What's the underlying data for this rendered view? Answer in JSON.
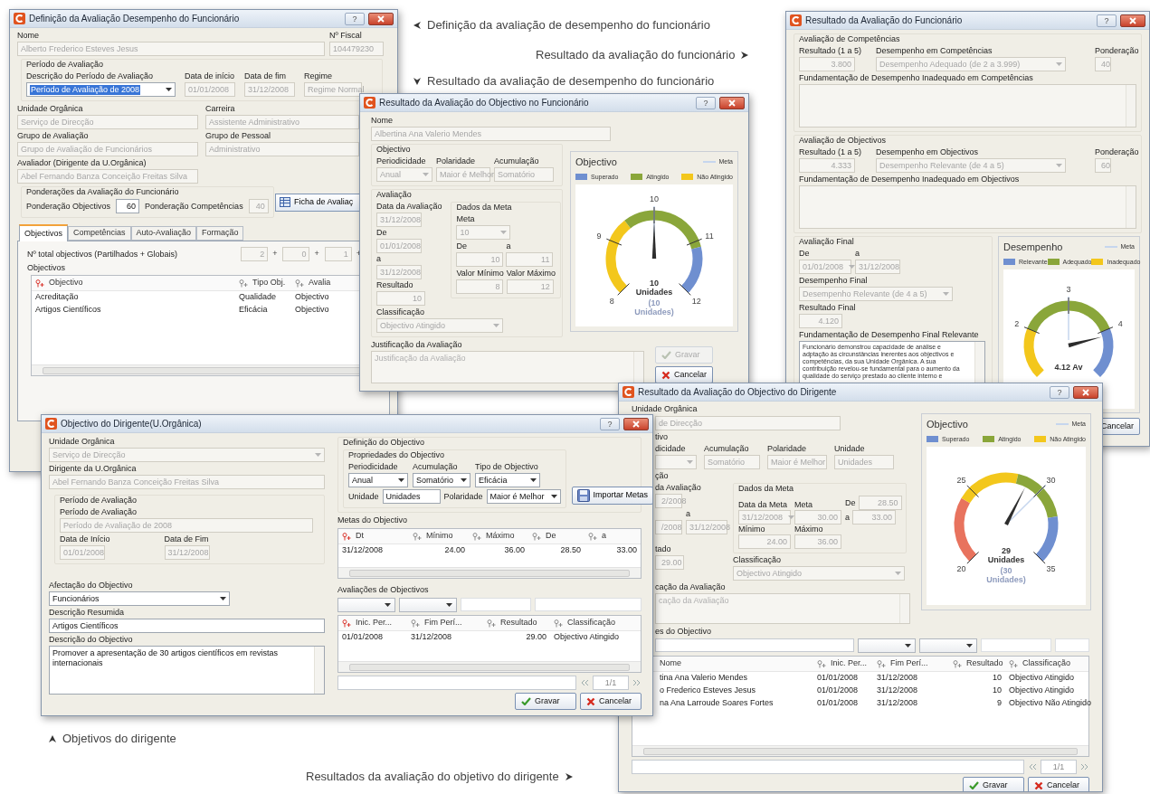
{
  "captions": [
    {
      "text": "Definição da avaliação de desempenho do funcionário",
      "kind": "left"
    },
    {
      "text": "Resultado da avaliação do funcionário",
      "kind": "right"
    },
    {
      "text": "Resultado da avaliação de desempenho do funcionário",
      "kind": "down"
    },
    {
      "text": "Objetivos do dirigente",
      "kind": "up"
    },
    {
      "text": "Resultados da avaliação do objetivo do dirigente",
      "kind": "right"
    }
  ],
  "windows": [
    {
      "kind": "definicao",
      "title": "Definição da Avaliação Desempenho do Funcionário",
      "help": "?",
      "nome": {
        "label": "Nome",
        "value": "Alberto Frederico Esteves Jesus",
        "kind": "text",
        "disabled": true
      },
      "nif": {
        "label": "Nº Fiscal",
        "value": "104479230",
        "kind": "text",
        "disabled": true
      },
      "periodo_group": "Período de Avaliação",
      "descricao": {
        "label": "Descrição do Período de Avaliação",
        "value": "Período de Avaliação de 2008",
        "kind": "combo",
        "disabled": false,
        "selected": true
      },
      "data_inicio": {
        "label": "Data de início",
        "value": "01/01/2008",
        "kind": "text",
        "disabled": true
      },
      "data_fim": {
        "label": "Data de fim",
        "value": "31/12/2008",
        "kind": "text",
        "disabled": true
      },
      "regime": {
        "label": "Regime",
        "value": "Regime Normal",
        "kind": "text",
        "disabled": true
      },
      "unidade": {
        "label": "Unidade Orgânica",
        "value": "Serviço de Direcção",
        "kind": "text",
        "disabled": true
      },
      "carreira": {
        "label": "Carreira",
        "value": "Assistente Administrativo",
        "kind": "text",
        "disabled": true
      },
      "grupo": {
        "label": "Grupo de Avaliação",
        "value": "Grupo de Avaliação de Funcionários",
        "kind": "text",
        "disabled": true
      },
      "pessoal": {
        "label": "Grupo de Pessoal",
        "value": "Administrativo",
        "kind": "text",
        "disabled": true
      },
      "avaliador": {
        "label": "Avaliador (Dirigente da U.Orgânica)",
        "value": "Abel Fernando Banza Conceição Freitas Silva",
        "kind": "text",
        "disabled": true
      },
      "ponderacoes_group": "Ponderações da Avaliação do Funcionário",
      "pond_obj": {
        "label": "Ponderação Objectivos",
        "value": "60",
        "kind": "text",
        "disabled": false
      },
      "pond_comp": {
        "label": "Ponderação Competências",
        "value": "40",
        "kind": "text",
        "disabled": true
      },
      "ficha_button": "Ficha de Avaliaç",
      "tabs": [
        {
          "label": "Objectivos",
          "selected": true
        },
        {
          "label": "Competências",
          "selected": false
        },
        {
          "label": "Auto-Avaliação",
          "selected": false
        },
        {
          "label": "Formação",
          "selected": false
        }
      ],
      "total_label": "Nº total objectivos (Partilhados + Globais)",
      "counts": [
        {
          "value": "2",
          "op": "+"
        },
        {
          "value": "0",
          "op": "+"
        },
        {
          "value": "1",
          "op": "+"
        }
      ],
      "objectivos_label": "Objectivos",
      "table": {
        "columns": [
          {
            "label": "Objectivo",
            "sorted": true
          },
          {
            "label": "Tipo Obj.",
            "sorted": false
          },
          {
            "label": "Avalia",
            "sorted": false
          }
        ],
        "rows": [
          [
            "Acreditação",
            "Qualidade",
            "Objectivo"
          ],
          [
            "Artigos Científicos",
            "Eficácia",
            "Objectivo"
          ]
        ]
      }
    },
    {
      "kind": "resultado_objectivo",
      "title": "Resultado da Avaliação do Objectivo no Funcionário",
      "help": "?",
      "nome": {
        "label": "Nome",
        "value": "Albertina Ana Valerio Mendes",
        "kind": "text",
        "disabled": true
      },
      "objectivo_group": "Objectivo",
      "periodicidade": {
        "label": "Periodicidade",
        "value": "Anual",
        "kind": "combo",
        "disabled": true
      },
      "polaridade": {
        "label": "Polaridade",
        "value": "Maior é Melhor",
        "kind": "text",
        "disabled": true
      },
      "acumulacao": {
        "label": "Acumulação",
        "value": "Somatório",
        "kind": "text",
        "disabled": true
      },
      "avaliacao_group": "Avaliação",
      "data_avaliacao": {
        "label": "Data da Avaliação",
        "value": "31/12/2008",
        "kind": "text",
        "disabled": true
      },
      "de": {
        "label": "De",
        "value": "01/01/2008",
        "kind": "text",
        "disabled": true
      },
      "a": {
        "label": "a",
        "value": "31/12/2008",
        "kind": "text",
        "disabled": true
      },
      "resultado": {
        "label": "Resultado",
        "value": "10",
        "kind": "text",
        "disabled": true
      },
      "meta_group": "Dados da Meta",
      "meta": {
        "label": "Meta",
        "value": "10",
        "kind": "combo",
        "disabled": true
      },
      "meta_de": {
        "label": "De",
        "value": "10",
        "kind": "text",
        "disabled": true
      },
      "meta_a": {
        "label": "a",
        "value": "11",
        "kind": "text",
        "disabled": true
      },
      "minimo": {
        "label": "Valor Mínimo",
        "value": "8",
        "kind": "text",
        "disabled": true
      },
      "maximo": {
        "label": "Valor Máximo",
        "value": "12",
        "kind": "text",
        "disabled": true
      },
      "classificacao": {
        "label": "Classificação",
        "value": "Objectivo Atingido",
        "kind": "combo",
        "disabled": true
      },
      "chart": {
        "title": "Objectivo",
        "target_legend": "Meta",
        "legend": [
          {
            "label": "Superado",
            "color": "#6f8fd0"
          },
          {
            "label": "Atingido",
            "color": "#8aa63a"
          },
          {
            "label": "Não Atingido",
            "color": "#f3c71c"
          }
        ],
        "gauge": {
          "ticks": [
            "8",
            "9",
            "10",
            "11",
            "12"
          ],
          "value": "10",
          "unit": "Unidades",
          "target_lines": [
            "(10",
            "Unidades)"
          ],
          "level": 0.5
        }
      },
      "justificacao": {
        "label": "Justificação da Avaliação",
        "placeholder": "Justificação da Avaliação",
        "kind": "textarea",
        "disabled": true
      },
      "buttons": [
        {
          "label": "Gravar",
          "kind": "save",
          "disabled": true
        },
        {
          "label": "Cancelar",
          "kind": "cancel",
          "disabled": false
        }
      ]
    },
    {
      "kind": "resultado_funcionario",
      "title": "Resultado da Avaliação do Funcionário",
      "help": "?",
      "competencias": {
        "group": "Avaliação de Competências",
        "resultado": {
          "label": "Resultado (1 a 5)",
          "value": "3.800",
          "kind": "text",
          "disabled": true
        },
        "desempenho": {
          "label": "Desempenho em Competências",
          "value": "Desempenho Adequado (de 2 a 3.999)",
          "kind": "combo",
          "disabled": true
        },
        "ponderacao": {
          "label": "Ponderação",
          "value": "40",
          "kind": "text",
          "disabled": true
        },
        "fundamentacao": {
          "label": "Fundamentação de Desempenho Inadequado em Competências",
          "kind": "textarea",
          "disabled": true
        }
      },
      "objectivos": {
        "group": "Avaliação de Objectivos",
        "resultado": {
          "label": "Resultado (1 a 5)",
          "value": "4.333",
          "kind": "text",
          "disabled": true
        },
        "desempenho": {
          "label": "Desempenho em Objectivos",
          "value": "Desempenho Relevante (de 4 a 5)",
          "kind": "combo",
          "disabled": true
        },
        "ponderacao": {
          "label": "Ponderação",
          "value": "60",
          "kind": "text",
          "disabled": true
        },
        "fundamentacao": {
          "label": "Fundamentação de Desempenho Inadequado em Objectivos",
          "kind": "textarea",
          "disabled": true
        }
      },
      "final": {
        "group": "Avaliação Final",
        "de": {
          "label": "De",
          "value": "01/01/2008",
          "kind": "combo",
          "disabled": true
        },
        "a": {
          "label": "a",
          "value": "31/12/2008",
          "kind": "text",
          "disabled": true
        },
        "desempenho": {
          "label": "Desempenho Final",
          "value": "Desempenho Relevante (de 4 a 5)",
          "kind": "combo",
          "disabled": true
        },
        "resultado": {
          "label": "Resultado Final",
          "value": "4.120",
          "kind": "text",
          "disabled": true
        },
        "fundamentacao": {
          "label": "Fundamentação de Desempenho Final Relevante",
          "kind": "textarea",
          "disabled": false,
          "lines": [
            "Funcionário demonstrou capacidade de análise e",
            "adptação às circunstâncias inerentes aos objectivos e",
            "competências, da sua Unidade Orgânica. A sua",
            "contribuição revelou-se fundamental para o aumento da",
            "qualidade do serviço prestado ao cliente interno e"
          ]
        }
      },
      "chart": {
        "title": "Desempenho",
        "target_legend": "Meta",
        "legend": [
          {
            "label": "Relevante",
            "color": "#6f8fd0"
          },
          {
            "label": "Adequado",
            "color": "#8aa63a"
          },
          {
            "label": "Inadequado",
            "color": "#f3c71c"
          }
        ],
        "gauge": {
          "ticks": [
            "2",
            "3",
            "4"
          ],
          "value": "4.12 Av",
          "level": 0.78
        }
      },
      "cancel_button": {
        "label": "Cancelar",
        "kind": "cancel",
        "disabled": false
      }
    },
    {
      "kind": "objectivo_dirigente",
      "title": "Objectivo do Dirigente(U.Orgânica)",
      "help": "?",
      "unidade": {
        "label": "Unidade Orgânica",
        "value": "Serviço de Direcção",
        "kind": "combo",
        "disabled": true
      },
      "dirigente": {
        "label": "Dirigente da U.Orgânica",
        "value": "Abel Fernando Banza Conceição Freitas Silva",
        "kind": "text",
        "disabled": true
      },
      "periodo_group": "Período de Avaliação",
      "periodo": {
        "label": "Período de Avaliação",
        "value": "Período de Avaliação de 2008",
        "kind": "text",
        "disabled": true
      },
      "inicio": {
        "label": "Data de Início",
        "value": "01/01/2008",
        "kind": "text",
        "disabled": true
      },
      "fim": {
        "label": "Data de Fim",
        "value": "31/12/2008",
        "kind": "text",
        "disabled": true
      },
      "afectacao": {
        "label": "Afectação do Objectivo",
        "value": "Funcionários",
        "kind": "combo",
        "disabled": false
      },
      "resumida": {
        "label": "Descrição Resumida",
        "value": "Artigos Científicos",
        "kind": "text",
        "disabled": false
      },
      "descricao": {
        "label": "Descrição do Objectivo",
        "value": "Promover a apresentação de 30 artigos científicos em revistas internacionais",
        "kind": "textarea",
        "disabled": false
      },
      "definicao_group": "Definição do Objectivo",
      "propriedades_group": "Propriedades do Objectivo",
      "periodicidade": {
        "label": "Periodicidade",
        "value": "Anual",
        "kind": "combo",
        "disabled": false
      },
      "acumulacao": {
        "label": "Acumulação",
        "value": "Somatório",
        "kind": "combo",
        "disabled": false
      },
      "tipo": {
        "label": "Tipo de Objectivo",
        "value": "Eficácia",
        "kind": "combo",
        "disabled": false
      },
      "unidade_medida": {
        "label": "Unidade",
        "value": "Unidades",
        "kind": "text",
        "disabled": false
      },
      "polaridade": {
        "label": "Polaridade",
        "value": "Maior é Melhor",
        "kind": "combo",
        "disabled": false
      },
      "importar_button": "Importar Metas",
      "metas": {
        "label": "Metas do Objectivo",
        "columns": [
          {
            "label": "Dt",
            "sorted": true
          },
          {
            "label": "Mínimo",
            "sorted": false
          },
          {
            "label": "Máximo",
            "sorted": false
          },
          {
            "label": "De",
            "sorted": false
          },
          {
            "label": "a",
            "sorted": false
          }
        ],
        "rows": [
          [
            "31/12/2008",
            "24.00",
            "36.00",
            "28.50",
            "33.00"
          ]
        ]
      },
      "avaliacoes": {
        "label": "Avaliações de Objectivos",
        "columns": [
          {
            "label": "Inic. Per...",
            "sorted": true
          },
          {
            "label": "Fim Perí...",
            "sorted": false
          },
          {
            "label": "Resultado",
            "sorted": false
          },
          {
            "label": "Classificação",
            "sorted": false
          }
        ],
        "rows": [
          [
            "01/01/2008",
            "31/12/2008",
            "29.00",
            "Objectivo Atingido"
          ]
        ],
        "page": "1/1"
      },
      "buttons": [
        {
          "label": "Gravar",
          "kind": "save",
          "disabled": false
        },
        {
          "label": "Cancelar",
          "kind": "cancel",
          "disabled": false
        }
      ]
    },
    {
      "kind": "resultado_dirigente",
      "title": "Resultado da Avaliação do Objectivo do Dirigente",
      "help": "?",
      "unidade_label": "Unidade Orgânica",
      "unidade": {
        "value": "de Direcção",
        "kind": "text",
        "disabled": true
      },
      "objectivo_group": "tivo",
      "periodicidade": {
        "label": "dicidade",
        "kind": "combo",
        "disabled": true
      },
      "acumulacao": {
        "label": "Acumulação",
        "value": "Somatório",
        "kind": "text",
        "disabled": true
      },
      "polaridade": {
        "label": "Polaridade",
        "value": "Maior é Melhor",
        "kind": "text",
        "disabled": true
      },
      "unidade_medida": {
        "label": "Unidade",
        "value": "Unidades",
        "kind": "text",
        "disabled": true
      },
      "avaliacao_group": "ção",
      "data_avaliacao": {
        "label": "da Avaliação",
        "value": "2/2008",
        "kind": "text",
        "disabled": true
      },
      "de": {
        "value": "/2008",
        "kind": "text",
        "disabled": true
      },
      "a": {
        "label": "a",
        "value": "31/12/2008",
        "kind": "text",
        "disabled": true
      },
      "resultado": {
        "label": "tado",
        "value": "29.00",
        "kind": "text",
        "disabled": true
      },
      "meta_group": "Dados da Meta",
      "data_meta": {
        "label": "Data da Meta",
        "value": "31/12/2008",
        "kind": "combo",
        "disabled": true
      },
      "meta": {
        "label": "Meta",
        "value": "30.00",
        "kind": "text",
        "disabled": true
      },
      "meta_de": {
        "label": "De",
        "value": "28.50",
        "kind": "text",
        "disabled": true
      },
      "meta_a": {
        "label": "a",
        "value": "33.00",
        "kind": "text",
        "disabled": true
      },
      "minimo": {
        "label": "Mínimo",
        "value": "24.00",
        "kind": "text",
        "disabled": true
      },
      "maximo": {
        "label": "Máximo",
        "value": "36.00",
        "kind": "text",
        "disabled": true
      },
      "classificacao": {
        "label": "Classificação",
        "value": "Objectivo Atingido",
        "kind": "combo",
        "disabled": true
      },
      "justificacao": {
        "label": "cação da Avaliação",
        "placeholder": "cação da Avaliação",
        "kind": "textarea",
        "disabled": true
      },
      "chart": {
        "title": "Objectivo",
        "target_legend": "Meta",
        "legend": [
          {
            "label": "Superado",
            "color": "#6f8fd0"
          },
          {
            "label": "Atingido",
            "color": "#8aa63a"
          },
          {
            "label": "Não Atingido",
            "color": "#f3c71c"
          }
        ],
        "gauge": {
          "ticks": [
            "25",
            "30",
            "20",
            "35"
          ],
          "value": "29",
          "unit": "Unidades",
          "target_lines": [
            "(30",
            "Unidades)"
          ],
          "level": 0.6
        }
      },
      "avaliacoes_label": "es do Objectivo",
      "table": {
        "columns": [
          {
            "label": "Nome"
          },
          {
            "label": "Inic. Per...",
            "sorted": false
          },
          {
            "label": "Fim Perí...",
            "sorted": false
          },
          {
            "label": "Resultado",
            "sorted": false
          },
          {
            "label": "Classificação",
            "sorted": false
          }
        ],
        "rows": [
          [
            "tina Ana Valerio Mendes",
            "01/01/2008",
            "31/12/2008",
            "10",
            "Objectivo Atingido"
          ],
          [
            "o Frederico Esteves Jesus",
            "01/01/2008",
            "31/12/2008",
            "10",
            "Objectivo Atingido"
          ],
          [
            "na Ana Larroude Soares Fortes",
            "01/01/2008",
            "31/12/2008",
            "9",
            "Objectivo Não Atingido"
          ]
        ]
      },
      "page": "1/1",
      "buttons": [
        {
          "label": "Gravar",
          "kind": "save",
          "disabled": false
        },
        {
          "label": "Cancelar",
          "kind": "cancel",
          "disabled": false
        }
      ]
    }
  ]
}
